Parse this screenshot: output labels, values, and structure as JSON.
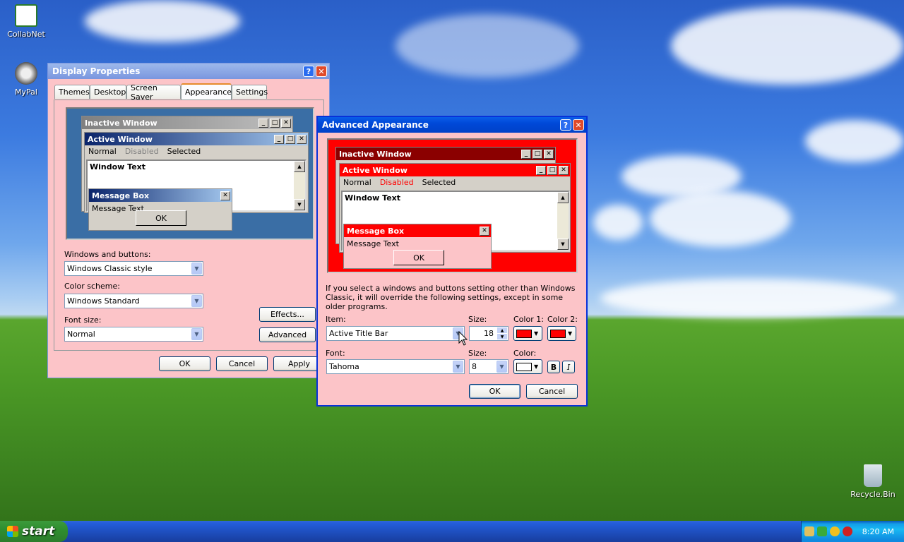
{
  "desktop": {
    "icons": [
      {
        "label": "CollabNet",
        "icon": "collabnet-icon"
      },
      {
        "label": "MyPal",
        "icon": "mypal-icon"
      },
      {
        "label": "Recycle.Bin",
        "icon": "recycle-bin-icon"
      }
    ]
  },
  "display_properties": {
    "title": "Display Properties",
    "help_glyph": "?",
    "close_glyph": "✕",
    "tabs": [
      "Themes",
      "Desktop",
      "Screen Saver",
      "Appearance",
      "Settings"
    ],
    "active_tab": "Appearance",
    "preview": {
      "inactive_title": "Inactive Window",
      "active_title": "Active Window",
      "menu": [
        "Normal",
        "Disabled",
        "Selected"
      ],
      "window_text": "Window Text",
      "message_box_title": "Message Box",
      "message_text": "Message Text",
      "ok": "OK"
    },
    "windows_buttons_label": "Windows and buttons:",
    "windows_buttons_value": "Windows Classic style",
    "color_scheme_label": "Color scheme:",
    "color_scheme_value": "Windows Standard",
    "font_size_label": "Font size:",
    "font_size_value": "Normal",
    "effects_button": "Effects...",
    "advanced_button": "Advanced",
    "ok": "OK",
    "cancel": "Cancel",
    "apply": "Apply"
  },
  "advanced_appearance": {
    "title": "Advanced Appearance",
    "help_glyph": "?",
    "close_glyph": "✕",
    "preview": {
      "inactive_title": "Inactive Window",
      "active_title": "Active Window",
      "menu": [
        "Normal",
        "Disabled",
        "Selected"
      ],
      "window_text": "Window Text",
      "message_box_title": "Message Box",
      "message_text": "Message Text",
      "ok": "OK"
    },
    "note": "If you select a windows and buttons setting other than Windows Classic, it will override the following settings, except in some older programs.",
    "item_label": "Item:",
    "item_value": "Active Title Bar",
    "size_label": "Size:",
    "size_value": "18",
    "color1_label": "Color 1:",
    "color1": "#ff0000",
    "color2_label": "Color 2:",
    "color2": "#ff0000",
    "font_label": "Font:",
    "font_value": "Tahoma",
    "font_size_label": "Size:",
    "font_size_value": "8",
    "font_color_label": "Color:",
    "font_color": "#ffffff",
    "bold_label": "B",
    "italic_label": "I",
    "ok": "OK",
    "cancel": "Cancel"
  },
  "taskbar": {
    "start_label": "start",
    "clock": "8:20 AM"
  },
  "colors": {
    "dialog_bg": "#fcc4c8",
    "preview_red": "#ff0000",
    "preview_dark_red": "#8b0000",
    "preview_blue": "#3a6ea5"
  }
}
